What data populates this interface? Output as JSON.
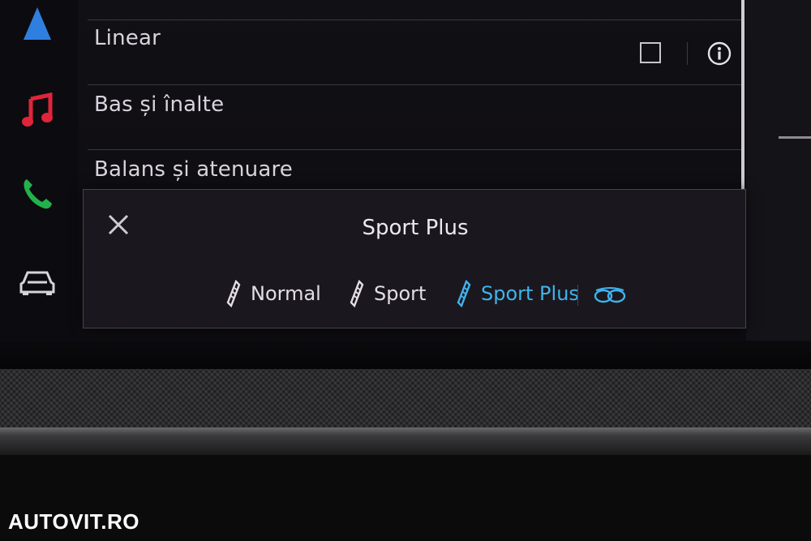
{
  "rail": {
    "icons": [
      "navigation-icon",
      "music-icon",
      "phone-icon",
      "car-icon"
    ],
    "colors": {
      "navigation": "#2f7fe0",
      "music": "#e0253a",
      "phone": "#22b14c",
      "car": "#d7d3dc"
    }
  },
  "list": {
    "items": [
      {
        "label": ""
      },
      {
        "label": "Linear"
      },
      {
        "label": "Bas și înalte"
      },
      {
        "label": "Balans și atenuare"
      }
    ]
  },
  "popup": {
    "title": "Sport Plus",
    "modes": [
      {
        "label": "Normal",
        "active": false
      },
      {
        "label": "Sport",
        "active": false
      },
      {
        "label": "Sport Plus",
        "active": true
      }
    ],
    "accent": "#3fb3ee"
  },
  "watermark": "AUTOVIT.RO"
}
